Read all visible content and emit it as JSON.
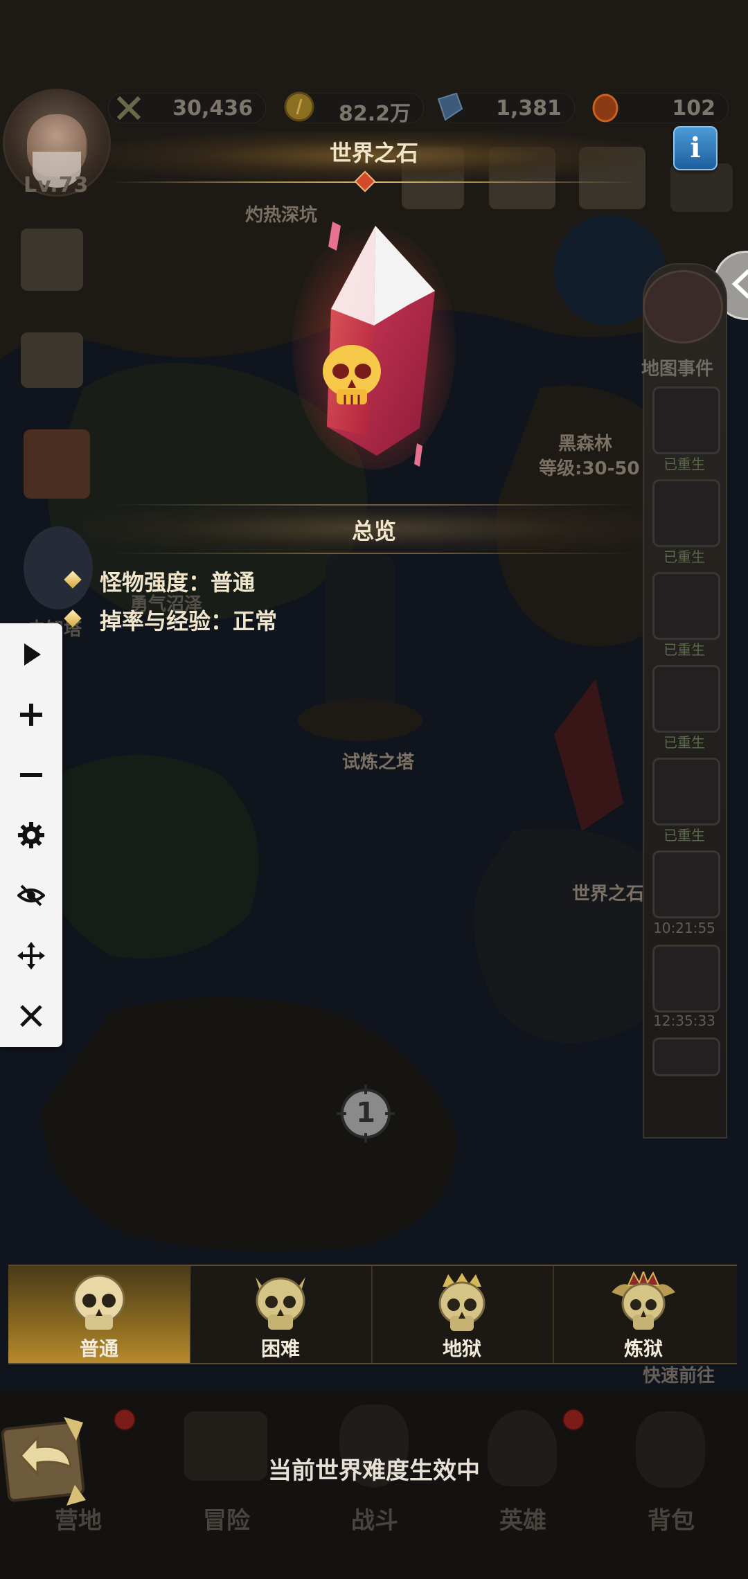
{
  "player": {
    "level": "Lv.73"
  },
  "resources": [
    {
      "name": "power",
      "icon": "crossed-swords-icon",
      "value": "30,436"
    },
    {
      "name": "gold",
      "icon": "gold-coin-icon",
      "value": "82.2万"
    },
    {
      "name": "diamond",
      "icon": "diamond-icon",
      "value": "1,381"
    },
    {
      "name": "gem",
      "icon": "orange-gem-icon",
      "value": "102"
    }
  ],
  "map": {
    "places": [
      {
        "name": "灼热深坑"
      },
      {
        "name": "黑森林",
        "level": "等级:30-50"
      },
      {
        "name": "试炼之塔"
      },
      {
        "name": "世界之石"
      },
      {
        "name": "勇气沼泽"
      },
      {
        "name": "未知塔"
      }
    ],
    "marker_number": "1"
  },
  "dialog": {
    "title": "世界之石",
    "overview_title": "总览",
    "stats": [
      "怪物强度：普通",
      "掉率与经验：正常"
    ]
  },
  "events": {
    "title": "地图事件",
    "items": [
      {
        "caption": "已重生"
      },
      {
        "caption": "已重生"
      },
      {
        "caption": "已重生"
      },
      {
        "caption": "已重生"
      },
      {
        "caption": "已重生"
      },
      {
        "caption": "10:21:55"
      },
      {
        "caption": "12:35:33"
      },
      {
        "caption": ""
      }
    ]
  },
  "toolbar": {
    "icons": [
      "play-icon",
      "plus-icon",
      "minus-icon",
      "gear-icon",
      "eye-off-icon",
      "move-icon",
      "close-icon"
    ]
  },
  "difficulty": {
    "tabs": [
      {
        "label": "普通",
        "active": true
      },
      {
        "label": "困难",
        "active": false
      },
      {
        "label": "地狱",
        "active": false
      },
      {
        "label": "炼狱",
        "active": false
      }
    ],
    "quick_label": "快速前往"
  },
  "bottom_nav": {
    "items": [
      "营地",
      "冒险",
      "战斗",
      "英雄",
      "背包"
    ]
  },
  "toast": "当前世界难度生效中",
  "colors": {
    "accent_gold": "#b88a2e",
    "title_text": "#f1e6cc",
    "info_blue": "#2f7fc4",
    "crystal_red": "#e03a3a"
  }
}
